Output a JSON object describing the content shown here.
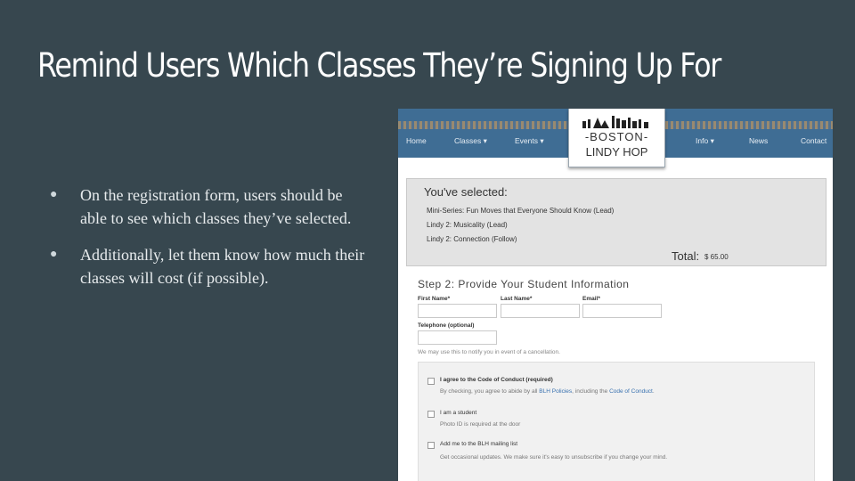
{
  "slide": {
    "title": "Remind Users Which Classes They’re Signing Up For",
    "bullets": [
      "On the registration form, users should be able to see which classes they’ve selected.",
      "Additionally, let them know how much their classes will cost (if possible)."
    ]
  },
  "site": {
    "nav_left": [
      {
        "label": "Home",
        "icon": ""
      },
      {
        "label": "Classes",
        "icon": "caret-down-icon"
      },
      {
        "label": "Events",
        "icon": "caret-down-icon"
      }
    ],
    "nav_right": [
      {
        "label": "Info",
        "icon": "caret-down-icon"
      },
      {
        "label": "News",
        "icon": ""
      },
      {
        "label": "Contact",
        "icon": ""
      }
    ],
    "logo_line1": "-BOSTON-",
    "logo_line2": "LINDY HOP"
  },
  "selected": {
    "title": "You've selected:",
    "classes": [
      "Mini-Series: Fun Moves that Everyone Should Know (Lead)",
      "Lindy 2: Musicality (Lead)",
      "Lindy 2: Connection (Follow)"
    ],
    "total_label": "Total:",
    "total_value": "$ 65.00"
  },
  "form": {
    "step_title": "Step 2: Provide Your Student Information",
    "first_name_label": "First Name*",
    "last_name_label": "Last Name*",
    "email_label": "Email*",
    "telephone_label": "Telephone (optional)",
    "first_name_value": "",
    "last_name_value": "",
    "email_value": "",
    "telephone_value": "",
    "telephone_hint": "We may use this to notify you in event of a cancellation."
  },
  "checks": [
    {
      "label": "I agree to the Code of Conduct (required)",
      "checked": false,
      "note_before": "By checking, you agree to abide by all ",
      "link1": "BLH Policies",
      "note_middle": ", including the ",
      "link2": "Code of Conduct",
      "note_after": "."
    },
    {
      "label": "I am a student",
      "checked": false,
      "note": "Photo ID is required at the door"
    },
    {
      "label": "Add me to the BLH mailing list",
      "checked": false,
      "note": "Get occasional updates. We make sure it's easy to unsubscribe if you change your mind."
    }
  ],
  "colors": {
    "slide_background": "#37474f",
    "nav_background": "#3f6d94",
    "link": "#3a72b0",
    "selected_panel": "#e3e3e3"
  }
}
